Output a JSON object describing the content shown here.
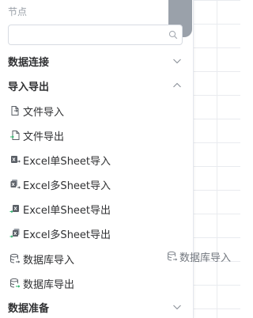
{
  "panel": {
    "node_label": "节点",
    "search": {
      "value": "",
      "placeholder": ""
    },
    "groups": {
      "data_connection": "数据连接",
      "import_export": "导入导出",
      "data_prep": "数据准备"
    },
    "items": [
      {
        "label": "文件导入",
        "icon": "file-import-icon"
      },
      {
        "label": "文件导出",
        "icon": "file-export-icon"
      },
      {
        "label": "Excel单Sheet导入",
        "icon": "excel-single-import-icon"
      },
      {
        "label": "Excel多Sheet导入",
        "icon": "excel-multi-import-icon"
      },
      {
        "label": "Excel单Sheet导出",
        "icon": "excel-single-export-icon"
      },
      {
        "label": "Excel多Sheet导出",
        "icon": "excel-multi-export-icon"
      },
      {
        "label": "数据库导入",
        "icon": "database-import-icon"
      },
      {
        "label": "数据库导出",
        "icon": "database-export-icon"
      }
    ]
  },
  "drag_ghost": {
    "label": "数据库导入",
    "icon": "database-import-icon"
  },
  "colors": {
    "text": "#303133",
    "muted": "#9aa0a8",
    "green": "#2fb06b",
    "gray_icon": "#5a5f66"
  }
}
